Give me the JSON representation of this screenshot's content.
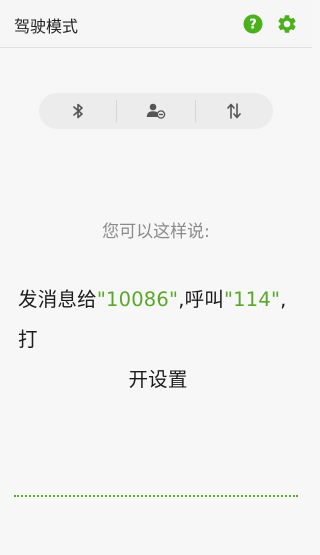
{
  "appbar": {
    "title": "驾驶模式",
    "help_icon": "question-circle-icon",
    "settings_icon": "gear-icon",
    "accent_color": "#4caf1d"
  },
  "toggle_bar": {
    "items": [
      {
        "icon": "bluetooth-icon"
      },
      {
        "icon": "contact-block-icon"
      },
      {
        "icon": "data-transfer-icon"
      }
    ]
  },
  "hint_text": "您可以这样说:",
  "example": {
    "part1": "发消息给",
    "number1": "\"10086\"",
    "part2": ",呼叫",
    "number2": "\"114\"",
    "part3": ",打",
    "line2": "开设置",
    "highlight_color": "#5aa82a"
  }
}
